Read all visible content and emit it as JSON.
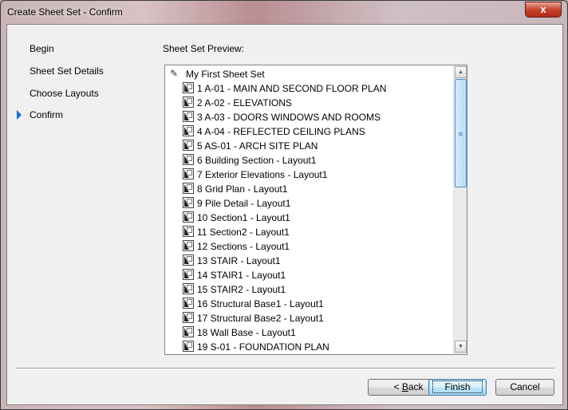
{
  "window": {
    "title": "Create Sheet Set - Confirm",
    "close_label": "x"
  },
  "nav": {
    "items": [
      {
        "label": "Begin"
      },
      {
        "label": "Sheet Set Details"
      },
      {
        "label": "Choose Layouts"
      },
      {
        "label": "Confirm",
        "current": true
      }
    ]
  },
  "preview": {
    "label": "Sheet Set Preview:",
    "root": "My First Sheet Set",
    "sheets": [
      "1 A-01 - MAIN AND SECOND FLOOR PLAN",
      "2 A-02 - ELEVATIONS",
      "3 A-03 - DOORS WINDOWS AND ROOMS",
      "4 A-04 - REFLECTED CEILING PLANS",
      "5 AS-01 - ARCH SITE PLAN",
      "6 Building Section - Layout1",
      "7 Exterior Elevations - Layout1",
      "8 Grid Plan - Layout1",
      "9 Pile Detail - Layout1",
      "10 Section1 - Layout1",
      "11 Section2 - Layout1",
      "12 Sections - Layout1",
      "13 STAIR - Layout1",
      "14 STAIR1 - Layout1",
      "15 STAIR2 - Layout1",
      "16 Structural Base1 - Layout1",
      "17 Structural Base2 - Layout1",
      "18 Wall Base - Layout1",
      "19 S-01 - FOUNDATION PLAN"
    ]
  },
  "buttons": {
    "back_prefix": "< ",
    "back_key": "B",
    "back_rest": "ack",
    "finish": "Finish",
    "cancel": "Cancel"
  },
  "colors": {
    "accent": "#1e6fd0"
  }
}
